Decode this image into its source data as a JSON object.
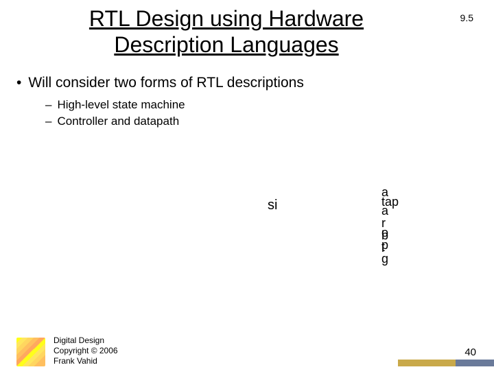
{
  "slide_number": "9.5",
  "title": "RTL Design using Hardware Description Languages",
  "main_bullet": "Will consider two forms of RTL descriptions",
  "sub_bullets": [
    "High-level state machine",
    "Controller and datapath"
  ],
  "fragments": {
    "si": "si",
    "atap_l1": "a",
    "atap_l2": "tap",
    "atap_l3": "a",
    "robpg_l1": "r",
    "robpg_l2": "o",
    "robpg_l3": "b",
    "robpg_l4": "p",
    "robpg_l5": "t",
    "robpg_l6": "g"
  },
  "footer": {
    "line1": "Digital Design",
    "line2": "Copyright © 2006",
    "line3": "Frank Vahid"
  },
  "page_number": "40"
}
